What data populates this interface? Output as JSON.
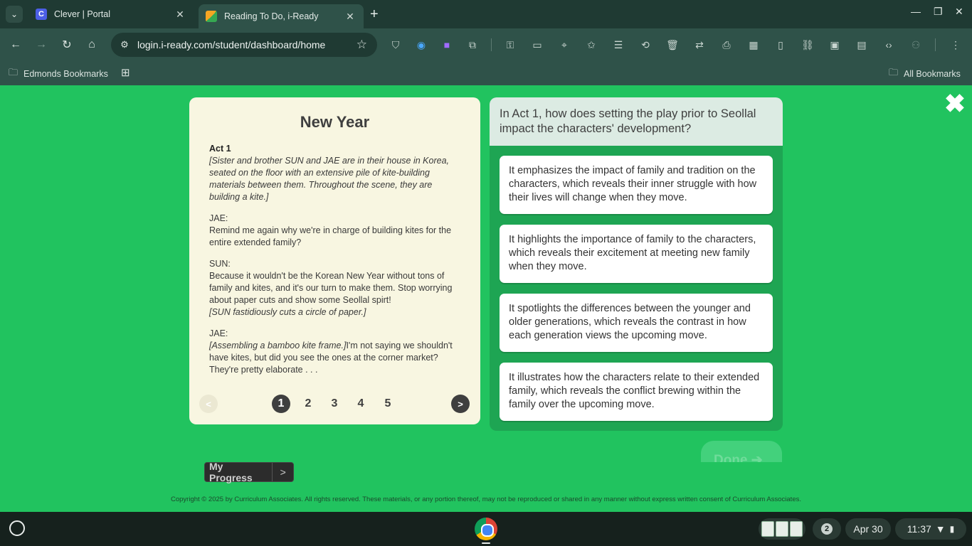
{
  "browser": {
    "tabs": [
      {
        "title": "Clever | Portal",
        "favicon": "C",
        "active": false
      },
      {
        "title": "Reading To Do, i-Ready",
        "active": true
      }
    ],
    "url": "login.i-ready.com/student/dashboard/home",
    "bookmarks": {
      "left": "Edmonds Bookmarks",
      "right": "All Bookmarks"
    }
  },
  "passage": {
    "title": "New Year",
    "act": "Act 1",
    "stage_direction": "[Sister and brother SUN and JAE are in their house in Korea, seated on the floor with an extensive pile of kite-building materials between them. Throughout the scene, they are building a kite.]",
    "lines": [
      {
        "speaker": "JAE:",
        "text": "Remind me again why we're in charge of building kites for the entire extended family?"
      },
      {
        "speaker": "SUN:",
        "text": "Because it wouldn't be the Korean New Year without tons of family and kites, and it's our turn to make them. Stop worrying about paper cuts and show some Seollal spirt!",
        "direction_after": "[SUN fastidiously cuts a circle of paper.]"
      },
      {
        "speaker": "JAE:",
        "direction_before": "[Assembling a bamboo kite frame.]",
        "text": "I'm not saying we shouldn't have kites, but did you see the ones at the corner market? They're pretty elaborate . . ."
      }
    ],
    "pager": {
      "prev": "<",
      "next": ">",
      "pages": [
        "1",
        "2",
        "3",
        "4",
        "5"
      ],
      "current": 1
    }
  },
  "question": {
    "prompt": "In Act 1, how does setting the play prior to Seollal impact the characters' development?",
    "choices": [
      "It emphasizes the impact of family and tradition on the characters, which reveals their inner struggle with how their lives will change when they move.",
      "It highlights the importance of family to the characters, which reveals their excitement at meeting new family when they move.",
      "It spotlights the differences between the younger and older generations, which reveals the contrast in how each generation views the upcoming move.",
      "It illustrates how the characters relate to their extended family, which reveals the conflict brewing within the family over the upcoming move."
    ]
  },
  "controls": {
    "close": "✖",
    "done": "Done ➔",
    "my_progress": "My Progress",
    "my_progress_arrow": ">"
  },
  "footer": {
    "copyright": "Copyright © 2025 by Curriculum Associates. All rights reserved. These materials, or any portion thereof, may not be reproduced or shared in any manner without express written consent of Curriculum Associates."
  },
  "shelf": {
    "notification_count": "2",
    "date": "Apr 30",
    "time": "11:37"
  },
  "colors": {
    "background": "#21c35f",
    "passage_bg": "#f8f6e1",
    "question_panel": "#1ea553",
    "question_header": "#dcebe3"
  }
}
